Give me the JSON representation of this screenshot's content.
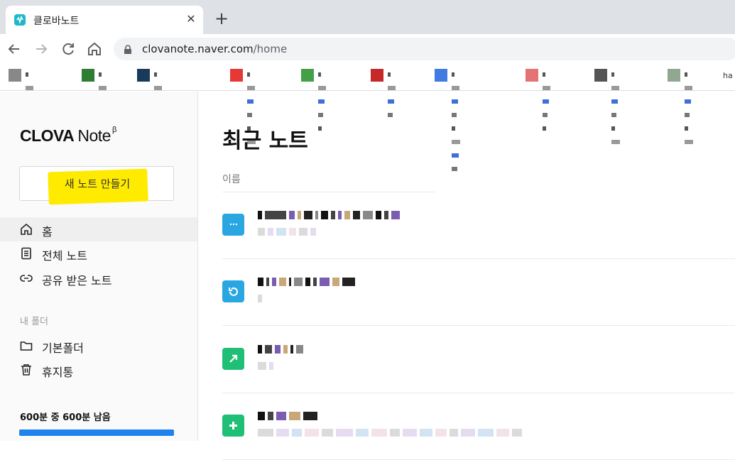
{
  "browser": {
    "tab_title": "클로바노트",
    "url_host": "clovanote.naver.com",
    "url_path": "/home"
  },
  "bookmarks": [
    {
      "icon": "bookmark-favicon-gray",
      "color": "#888"
    },
    {
      "icon": "bookmark-favicon-green",
      "color": "#2e7d32"
    },
    {
      "icon": "bookmark-favicon-navy",
      "color": "#1a3a5c"
    },
    {
      "icon": "bookmark-favicon-red",
      "color": "#e53935"
    },
    {
      "icon": "bookmark-favicon-green2",
      "color": "#43a047"
    },
    {
      "icon": "bookmark-favicon-red2",
      "color": "#c62828"
    },
    {
      "icon": "bookmark-favicon-blue",
      "color": "#3f7be0"
    },
    {
      "icon": "bookmark-favicon-multi",
      "color": "#e57373"
    },
    {
      "icon": "bookmark-favicon-dark",
      "color": "#555"
    },
    {
      "icon": "bookmark-favicon-sage",
      "color": "#8fa88f"
    }
  ],
  "bookmark_overflow": "ha",
  "sidebar": {
    "logo_main": "CLOVA",
    "logo_note": "Note",
    "logo_sup": "β",
    "new_note": "새 노트 만들기",
    "nav": [
      {
        "label": "홈",
        "icon": "home-icon",
        "active": true
      },
      {
        "label": "전체 노트",
        "icon": "document-icon",
        "active": false
      },
      {
        "label": "공유 받은 노트",
        "icon": "link-icon",
        "active": false
      }
    ],
    "folders_title": "내 폴더",
    "folders": [
      {
        "label": "기본폴더",
        "icon": "folder-icon"
      },
      {
        "label": "휴지통",
        "icon": "trash-icon"
      }
    ],
    "quota_text": "600분 중 600분 남음",
    "quota_fraction": 1.0,
    "accent": "#1f82ee"
  },
  "main": {
    "title": "최근 노트",
    "column_header": "이름",
    "notes": [
      {
        "icon": "note-chat-icon",
        "color": "#2aa7e0"
      },
      {
        "icon": "note-refresh-icon",
        "color": "#2aa7e0"
      },
      {
        "icon": "note-share-icon",
        "color": "#1fbf75"
      },
      {
        "icon": "note-plus-icon",
        "color": "#1fbf75"
      }
    ]
  }
}
